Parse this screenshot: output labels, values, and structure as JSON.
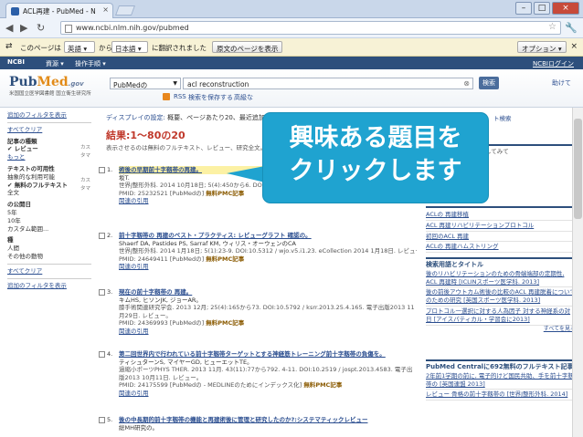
{
  "browser": {
    "tab_title": "ACL再建 - PubMed - N",
    "tab_close": "×",
    "url": "www.ncbi.nlm.nih.gov/pubmed",
    "win_min": "–",
    "win_max": "□",
    "win_close": "×"
  },
  "translate_bar": {
    "prefix": "このページは",
    "from_lang": "英語",
    "from_label": "から",
    "to_lang": "日本語",
    "status": "に翻訳されました",
    "show_original": "原文のページを表示",
    "options": "オプション",
    "close": "×"
  },
  "ncbi_bar": {
    "logo": "NCBI",
    "resources": "資源",
    "how_to": "操作手順",
    "login": "NCBIログイン"
  },
  "pubmed_header": {
    "logo_pub": "Pub",
    "logo_med": "Med",
    "logo_gov": ".gov",
    "subtitle": "米国国立医学図書館 国立衛生研究所",
    "db_select": "PubMedの",
    "query": "acl reconstruction",
    "search_button": "検索",
    "rss": "RSS",
    "save_search": "検索を保存する",
    "advanced": "高級な",
    "help": "助けて"
  },
  "left_sidebar": {
    "show_filters": "追加のフィルタを表示",
    "clear_all_top": "すべてクリア",
    "article_types_h": "記事の種類",
    "article_review": "レビュー",
    "article_more": "もっと",
    "text_avail_h": "テキストの可用性",
    "text_abstract": "抽象的な利用可能",
    "text_free_full": "無料のフルテキスト",
    "text_full": "全文",
    "pubdate_h": "の公開日",
    "pub_5y": "5年",
    "pub_10y": "10年",
    "pub_custom": "カスタム範囲...",
    "species_h": "種",
    "species_human": "人間",
    "species_other": "その他の動物",
    "clear_all_bottom": "すべてクリア",
    "show_filters_bottom": "追加のフィルタを表示",
    "customize": "カスタマ"
  },
  "display_bar": {
    "display_settings": "ディスプレイの設定:",
    "settings_value": "概要、ページあたり20、最近追加"
  },
  "results_header": {
    "title": "結果:1〜80の20",
    "note": "表示させるのは無料のフルテキスト、レビュー、研究全文。すべての取り除く"
  },
  "results": [
    {
      "num": "1.",
      "title": "術後の早期前十字靱帯の再建。",
      "authors": "坂T.",
      "citation": "世界J整形外科. 2014 10月18日; 5(4):450から6. DOI:10.5312 / wjo.v5.i4.450。",
      "pmid": "PMID: 25232521 [PubMedの]",
      "free": "無料PMC記事",
      "related": "関連の引用"
    },
    {
      "num": "2.",
      "title": "前十字靱帯の 再建のベスト・プラクティス: レビューグラフト 確認の。",
      "authors": "Shaerf DA, Pastides PS, Sarraf KM, ウィリス・オーウェンのCA",
      "citation": "世界J整形外科. 2014 1月18日; 5(1):23-9. DOI:10.5312 / wjo.v5.i1.23. eCollection 2014 1月18日. レビュー。",
      "pmid": "PMID: 24649411 [PubMedの]",
      "free": "無料PMC記事",
      "related": "関連の引用"
    },
    {
      "num": "3.",
      "title": "現在の前十字靱帯の 再建。",
      "authors": "キムHS, ヒソンJK, ジョーAR。",
      "citation": "膝手術関連研究学会. 2013 12月; 25(4):165から73. DOI:10.5792 / ksrr.2013.25.4.165. 電子出版2013 11月29日. レビュー。",
      "pmid": "PMID: 24369993 [PubMedの]",
      "free": "無料PMC記事",
      "related": "関連の引用"
    },
    {
      "num": "4.",
      "title": "第二回世界内で行われている前十字靱帯ターゲットとする神経筋トレーニング前十字靱帯の負傷を。",
      "authors": "ティシュターンS, マイヤーGD, ヒューエットTE。",
      "citation": "過縮小ポーツPHYS THER. 2013 11月. 43(11):77から792. 4-11. DOI:10.2519 / jospt.2013.4583. 電子出版2013 10月11日. レビュー。",
      "pmid": "PMID: 24175599 [PubMedの - MEDLINEのためにインデックス化]",
      "free": "無料PMC記事",
      "related": "関連の引用"
    },
    {
      "num": "5.",
      "title": "後の中長期的前十字靱帯の機能と再建術後に管理と研究したのか?:システマティックレビュー",
      "authors": "総MH研究の。",
      "citation": "",
      "pmid": "",
      "free": "",
      "related": ""
    }
  ],
  "callout": {
    "line1": "興味ある題目を",
    "line2": "クリックします"
  },
  "right_sidebar": {
    "box1_lines": [
      "当たリオプション検討してみて"
    ],
    "box2_links": [
      "ACLの 再建移植",
      "ACL 再建リハビリテーションプロトコル",
      "初回のACL 再建",
      "ACLの 再建ハムストリング"
    ],
    "box3_title": "検索用語とタイトル",
    "box3_links": [
      "後のリハビリテーションのための骨端端部の定期性, ACL 再建時 [ICLINスポーツ医学科. 2013]",
      "後の前後アウトカム術後の比較のACL 再建脱着についてのための研究 [英国スポーツ医学科. 2013]",
      "プロトコル一選択に対する人為因子 対する神経系の対日 [アイスパティカル・学習会に2013]"
    ],
    "box3_more": "すべてを見る",
    "box4_title": "PubMed Centralに692無料のフルテキスト記事",
    "box4_links": [
      "2年前1学期の前に, 電子的けど国民共助、手を前十字靱帯の [英国連盟 2013]",
      "レビュー 骨格の前十字靱帯の [世界J整形外科. 2014]"
    ]
  },
  "trunc_right": "ト検索"
}
